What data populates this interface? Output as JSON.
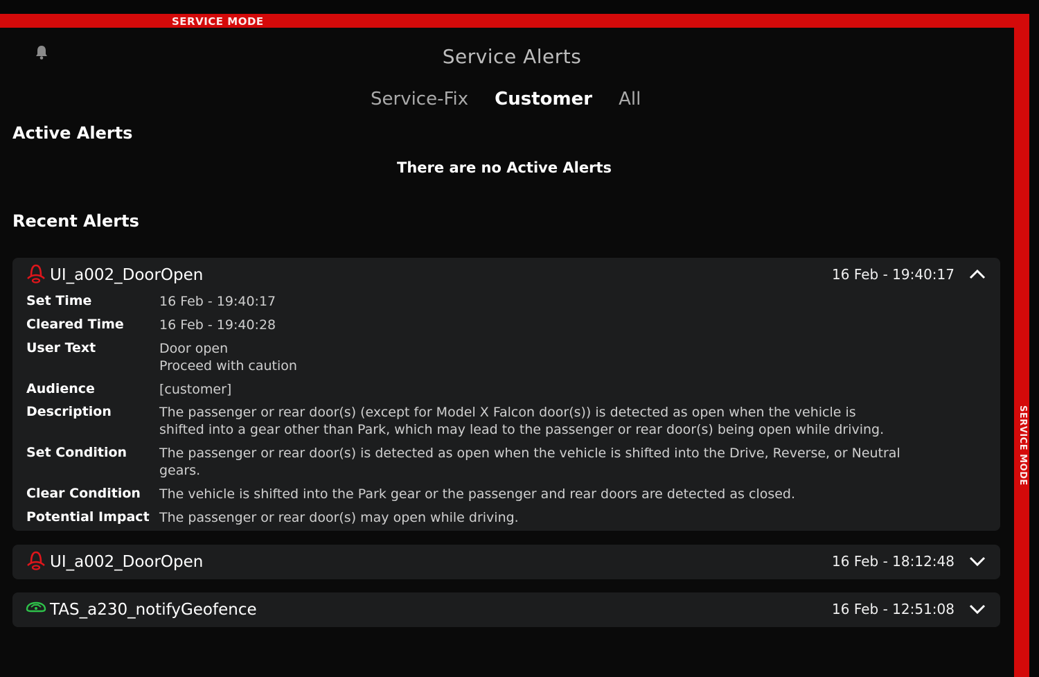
{
  "frame": {
    "label_top": "SERVICE MODE",
    "label_side": "SERVICE MODE",
    "accent_color": "#d40a0a"
  },
  "header": {
    "bell_icon": "bell-icon",
    "title": "Service Alerts"
  },
  "tabs": [
    {
      "label": "Service-Fix",
      "active": false
    },
    {
      "label": "Customer",
      "active": true
    },
    {
      "label": "All",
      "active": false
    }
  ],
  "active_alerts": {
    "heading": "Active Alerts",
    "empty_message": "There are no Active Alerts"
  },
  "recent_alerts": {
    "heading": "Recent Alerts",
    "items": [
      {
        "name": "UI_a002_DoorOpen",
        "time": "16 Feb - 19:40:17",
        "icon": "door-open-icon",
        "icon_color": "#e0151b",
        "expanded": true,
        "details": [
          {
            "label": "Set Time",
            "lines": [
              "16 Feb - 19:40:17"
            ]
          },
          {
            "label": "Cleared Time",
            "lines": [
              "16 Feb - 19:40:28"
            ]
          },
          {
            "label": "User Text",
            "lines": [
              "Door open",
              "Proceed with caution"
            ]
          },
          {
            "label": "Audience",
            "lines": [
              "[customer]"
            ]
          },
          {
            "label": "Description",
            "lines": [
              "The passenger or rear door(s) (except for Model X Falcon door(s)) is detected as open when the vehicle is",
              "shifted into a gear other than Park, which may lead to the passenger or rear door(s) being open while driving."
            ]
          },
          {
            "label": "Set Condition",
            "lines": [
              "The passenger or rear door(s) is detected as open when the vehicle is shifted into the Drive, Reverse, or Neutral",
              "gears."
            ]
          },
          {
            "label": "Clear Condition",
            "lines": [
              "The vehicle is shifted into the Park gear or the passenger and rear doors are detected as closed."
            ]
          },
          {
            "label": "Potential Impact",
            "lines": [
              "The passenger or rear door(s) may open while driving."
            ]
          }
        ]
      },
      {
        "name": "UI_a002_DoorOpen",
        "time": "16 Feb - 18:12:48",
        "icon": "door-open-icon",
        "icon_color": "#e0151b",
        "expanded": false
      },
      {
        "name": "TAS_a230_notifyGeofence",
        "time": "16 Feb - 12:51:08",
        "icon": "vehicle-geofence-icon",
        "icon_color": "#2ec24a",
        "expanded": false
      }
    ]
  }
}
